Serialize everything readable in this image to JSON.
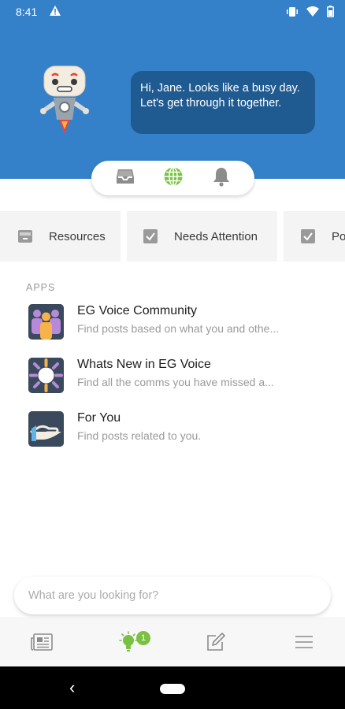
{
  "status_bar": {
    "time": "8:41",
    "icons": [
      "warning-icon",
      "vibrate-icon",
      "wifi-icon",
      "battery-icon"
    ]
  },
  "header": {
    "greeting": "Hi, Jane. Looks like a busy day. Let's get through it together.",
    "background_color": "#3581c9",
    "bubble_color": "#1f5a91"
  },
  "switcher": {
    "items": [
      {
        "icon": "inbox-icon",
        "active": false
      },
      {
        "icon": "globe-icon",
        "active": true
      },
      {
        "icon": "bell-icon",
        "active": false
      }
    ],
    "active_color": "#7ac143"
  },
  "chips": [
    {
      "label": "Resources",
      "icon": "archive-icon"
    },
    {
      "label": "Needs Attention",
      "icon": "checkbox-icon"
    },
    {
      "label": "Po",
      "icon": "checkbox-icon"
    }
  ],
  "apps": {
    "section_title": "APPS",
    "items": [
      {
        "name": "EG Voice Community",
        "description": "Find posts based on what you and othe...",
        "icon": "community-icon"
      },
      {
        "name": "Whats New in EG Voice",
        "description": "Find all the comms you have missed a...",
        "icon": "sun-icon"
      },
      {
        "name": "For You",
        "description": "Find posts related to you.",
        "icon": "hand-icon"
      }
    ]
  },
  "search": {
    "placeholder": "What are you looking for?",
    "value": ""
  },
  "bottom_nav": {
    "items": [
      {
        "icon": "newspaper-icon",
        "active": false
      },
      {
        "icon": "lightbulb-icon",
        "active": true,
        "badge": "1"
      },
      {
        "icon": "compose-icon",
        "active": false
      },
      {
        "icon": "menu-icon",
        "active": false
      }
    ]
  },
  "system_nav": {
    "back_glyph": "‹"
  }
}
